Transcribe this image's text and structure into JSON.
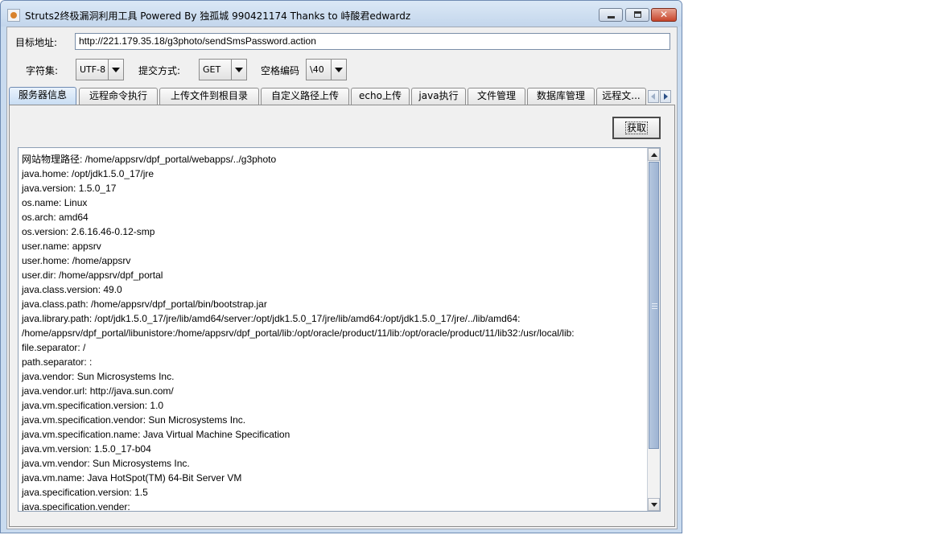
{
  "window": {
    "title": "Struts2终极漏洞利用工具   Powered By 独孤城 990421174 Thanks to 峙酸君edwardz",
    "min_glyph": "",
    "max_glyph": "",
    "close_glyph": "✕"
  },
  "form": {
    "target_label": "目标地址:",
    "target_value": "http://221.179.35.18/g3photo/sendSmsPassword.action",
    "charset_label": "字符集:",
    "charset_value": "UTF-8",
    "method_label": "提交方式:",
    "method_value": "GET",
    "space_label": "空格编码",
    "space_value": "\\40"
  },
  "tabs": [
    {
      "label": "服务器信息"
    },
    {
      "label": "远程命令执行"
    },
    {
      "label": "上传文件到根目录"
    },
    {
      "label": "自定义路径上传"
    },
    {
      "label": "echo上传"
    },
    {
      "label": "java执行"
    },
    {
      "label": "文件管理"
    },
    {
      "label": "数据库管理"
    },
    {
      "label": "远程文..."
    }
  ],
  "panel": {
    "fetch_label": "获取",
    "lines": [
      "网站物理路径:  /home/appsrv/dpf_portal/webapps/../g3photo",
      "java.home: /opt/jdk1.5.0_17/jre",
      "java.version: 1.5.0_17",
      "os.name: Linux",
      "os.arch: amd64",
      "os.version: 2.6.16.46-0.12-smp",
      "user.name: appsrv",
      "user.home: /home/appsrv",
      "user.dir: /home/appsrv/dpf_portal",
      "java.class.version: 49.0",
      "java.class.path: /home/appsrv/dpf_portal/bin/bootstrap.jar",
      "java.library.path: /opt/jdk1.5.0_17/jre/lib/amd64/server:/opt/jdk1.5.0_17/jre/lib/amd64:/opt/jdk1.5.0_17/jre/../lib/amd64:",
      "/home/appsrv/dpf_portal/libunistore:/home/appsrv/dpf_portal/lib:/opt/oracle/product/11/lib:/opt/oracle/product/11/lib32:/usr/local/lib:",
      "file.separator: /",
      "path.separator: :",
      "java.vendor: Sun Microsystems Inc.",
      "java.vendor.url: http://java.sun.com/",
      "java.vm.specification.version: 1.0",
      "java.vm.specification.vendor: Sun Microsystems Inc.",
      "java.vm.specification.name: Java Virtual Machine Specification",
      "java.vm.version: 1.5.0_17-b04",
      "java.vm.vendor: Sun Microsystems Inc.",
      "java.vm.name: Java HotSpot(TM) 64-Bit Server VM",
      "java.specification.version: 1.5",
      "java.specification.vender:"
    ]
  }
}
